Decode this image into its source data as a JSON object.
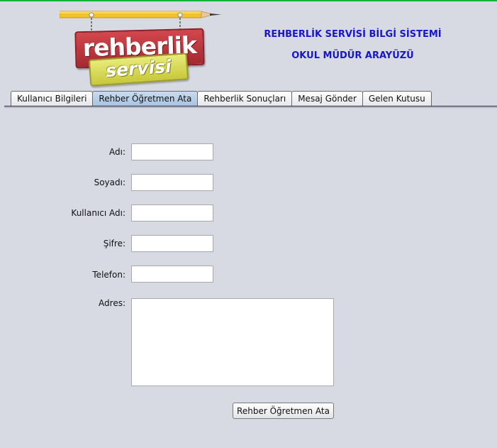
{
  "header": {
    "logo": {
      "line1": "rehberlik",
      "line2": "servisi"
    },
    "title": "REHBERLİK SERVİSİ BİLGİ SİSTEMİ",
    "subtitle": "OKUL MÜDÜR ARAYÜZÜ",
    "title_color": "#1616cf"
  },
  "tabs": [
    {
      "label": "Kullanıcı Bilgileri",
      "active": false
    },
    {
      "label": "Rehber Öğretmen Ata",
      "active": true
    },
    {
      "label": "Rehberlik Sonuçları",
      "active": false
    },
    {
      "label": "Mesaj Gönder",
      "active": false
    },
    {
      "label": "Gelen Kutusu",
      "active": false
    }
  ],
  "form": {
    "name_label": "Adı:",
    "name_value": "",
    "surname_label": "Soyadı:",
    "surname_value": "",
    "username_label": "Kullanıcı Adı:",
    "username_value": "",
    "password_label": "Şifre:",
    "password_value": "",
    "phone_label": "Telefon:",
    "phone_value": "",
    "address_label": "Adres:",
    "address_value": "",
    "submit_label": "Rehber Öğretmen Ata"
  },
  "colors": {
    "background": "#d8dae3",
    "top_border": "#14b23a",
    "active_tab": "#b4cce6"
  }
}
